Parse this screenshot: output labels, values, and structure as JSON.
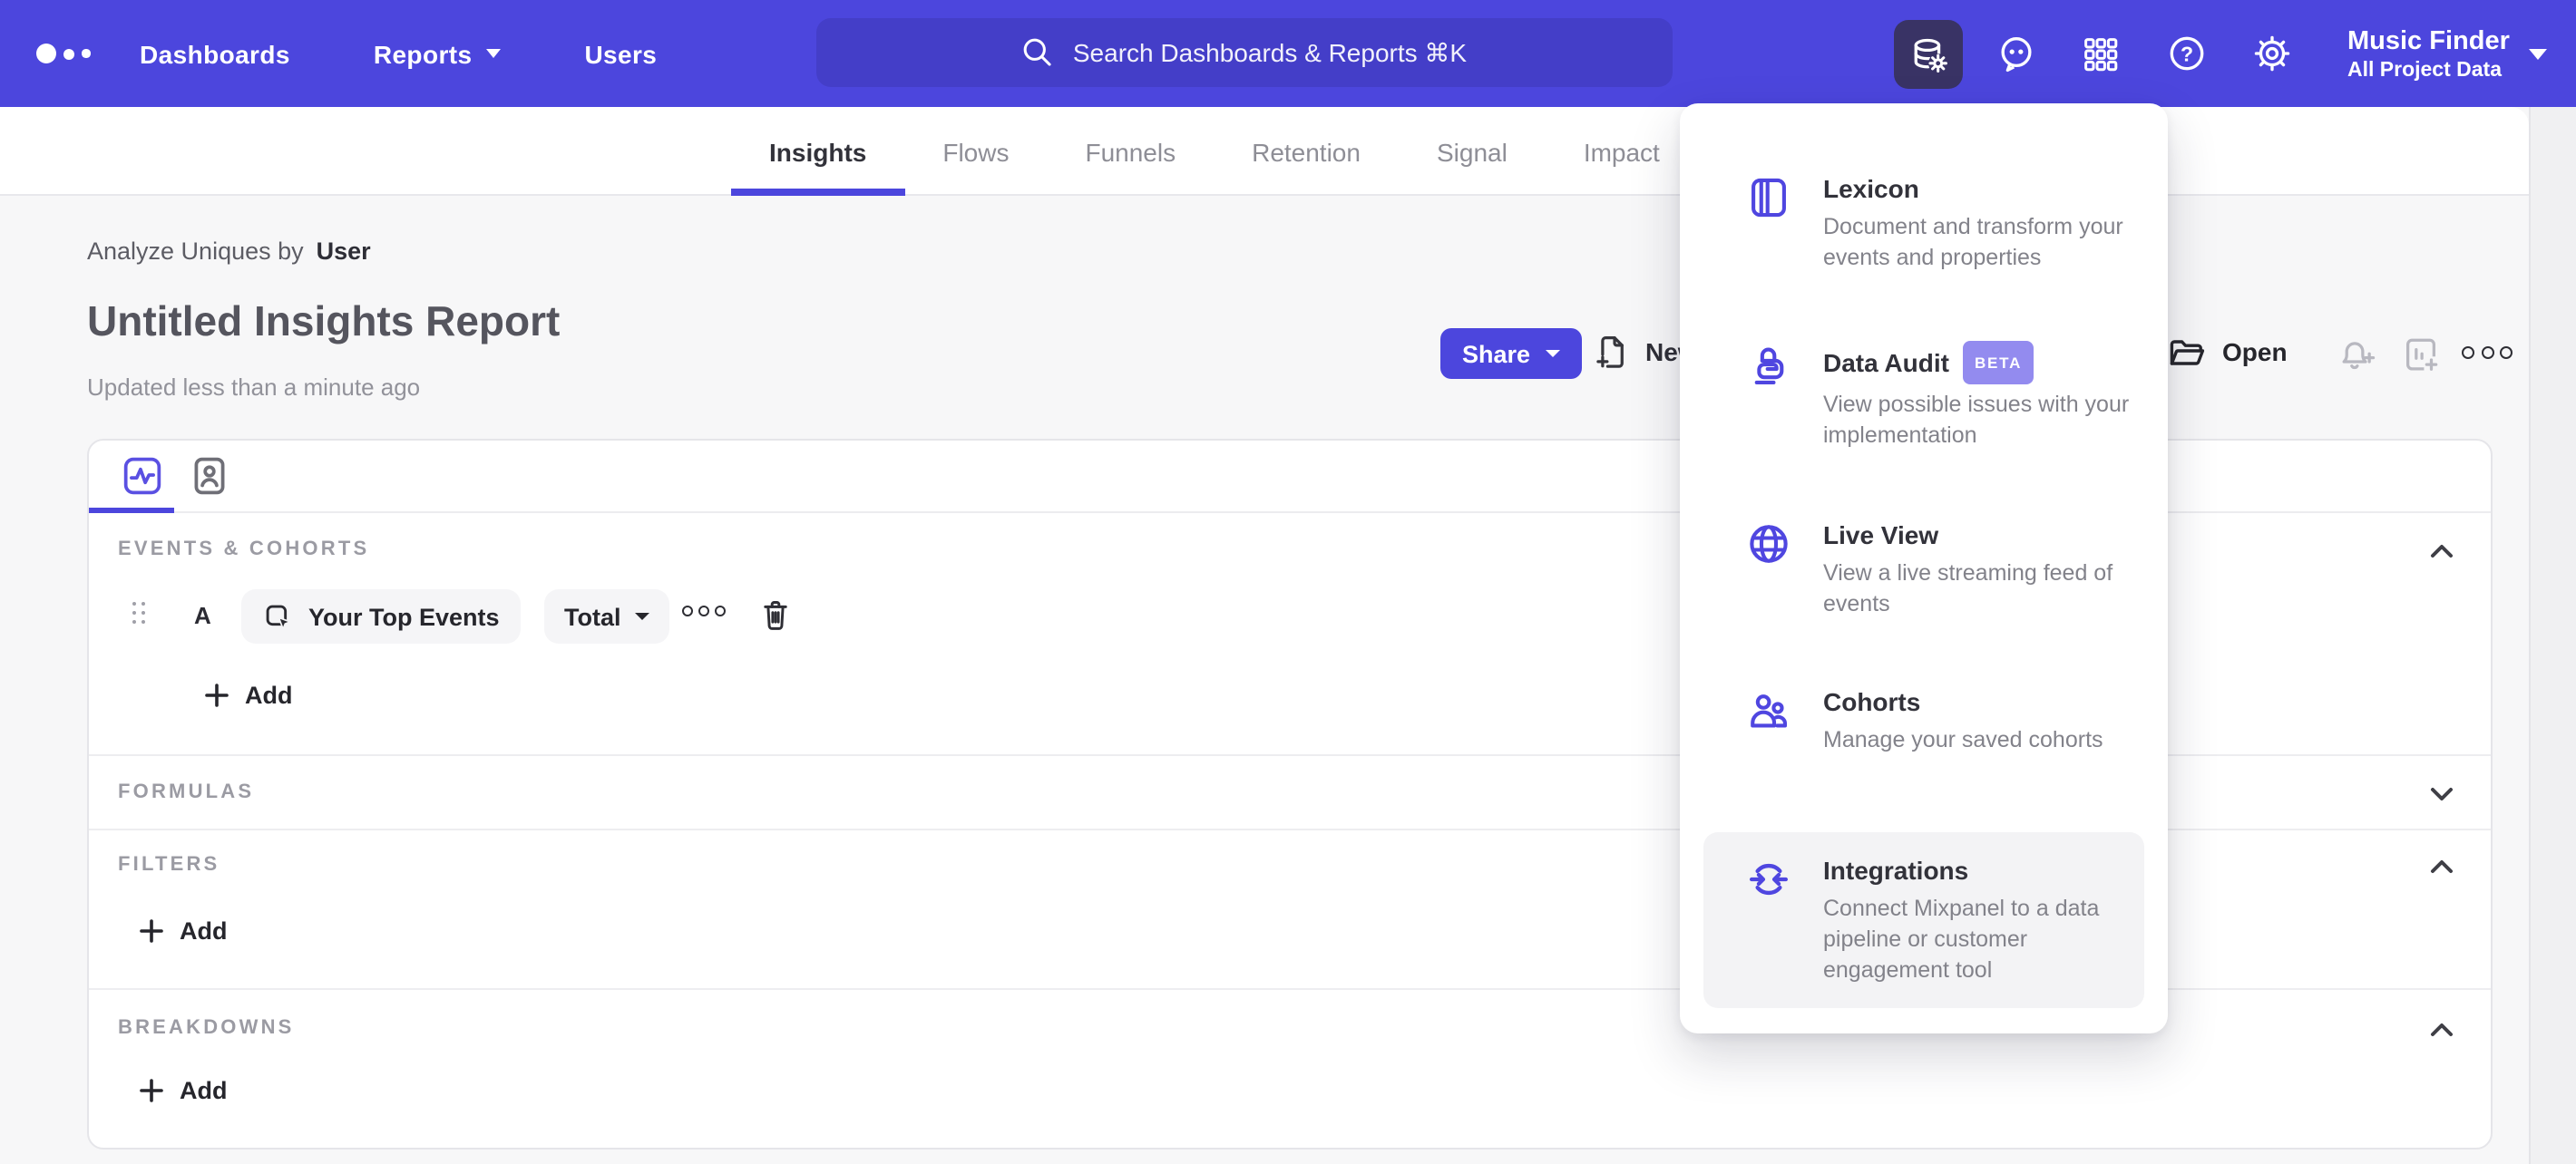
{
  "nav": {
    "items": [
      {
        "label": "Dashboards"
      },
      {
        "label": "Reports"
      },
      {
        "label": "Users"
      }
    ],
    "search_placeholder": "Search Dashboards & Reports ⌘K",
    "project_name": "Music Finder",
    "project_scope": "All Project Data"
  },
  "tabs": [
    {
      "label": "Insights"
    },
    {
      "label": "Flows"
    },
    {
      "label": "Funnels"
    },
    {
      "label": "Retention"
    },
    {
      "label": "Signal"
    },
    {
      "label": "Impact"
    }
  ],
  "report": {
    "analyze_label": "Analyze Uniques by",
    "analyze_value": "User",
    "title": "Untitled Insights Report",
    "updated": "Updated less than a minute ago",
    "share_label": "Share",
    "new_label": "New",
    "open_label": "Open"
  },
  "builder": {
    "events_header": "EVENTS & COHORTS",
    "formulas_header": "FORMULAS",
    "filters_header": "FILTERS",
    "breakdowns_header": "BREAKDOWNS",
    "row_letter": "A",
    "event_label": "Your Top Events",
    "metric_label": "Total",
    "add_label": "Add"
  },
  "menu": {
    "items": [
      {
        "title": "Lexicon",
        "desc": "Document and transform your events and properties"
      },
      {
        "title": "Data Audit",
        "badge": "BETA",
        "desc": "View possible issues with your implementation"
      },
      {
        "title": "Live View",
        "desc": "View a live streaming feed of events"
      },
      {
        "title": "Cohorts",
        "desc": "Manage your saved cohorts"
      },
      {
        "title": "Integrations",
        "desc": "Connect Mixpanel to a data pipeline or customer engagement tool"
      }
    ]
  },
  "colors": {
    "accent": "#4c46dd",
    "nav_bg": "#4c46dd",
    "search_bg": "#443ec8",
    "active_tool_bg": "#393365",
    "menu_icon": "#4f46e0",
    "beta_badge_bg": "#938bef",
    "page_bg": "#f7f7f8",
    "highlight_bg": "#f3f3f5"
  }
}
